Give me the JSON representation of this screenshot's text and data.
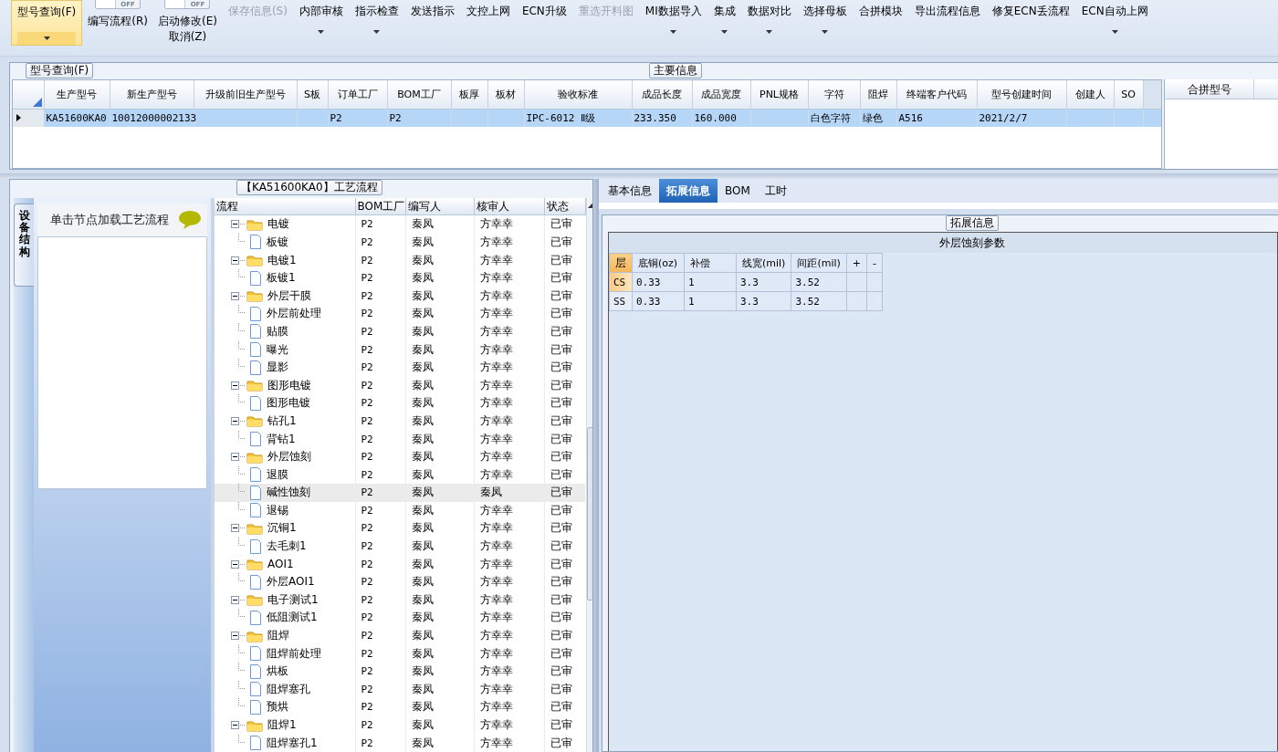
{
  "toolbar": [
    {
      "kind": "button",
      "label": "型号查询(F)",
      "dropdown": true,
      "selected": true,
      "disabled": false
    },
    {
      "kind": "toggle",
      "toggle": "OFF",
      "on": false,
      "lines": [
        "编写流程(R)"
      ]
    },
    {
      "kind": "toggle",
      "toggle": "OFF",
      "on": false,
      "lines": [
        "启动修改(E)",
        "取消(Z)"
      ]
    },
    {
      "kind": "button",
      "label": "保存信息(S)",
      "dropdown": false,
      "selected": false,
      "disabled": true
    },
    {
      "kind": "button",
      "label": "内部审核",
      "dropdown": true,
      "selected": false,
      "disabled": false
    },
    {
      "kind": "button",
      "label": "指示检查",
      "dropdown": true,
      "selected": false,
      "disabled": false
    },
    {
      "kind": "button",
      "label": "发送指示",
      "dropdown": false,
      "selected": false,
      "disabled": false
    },
    {
      "kind": "button",
      "label": "文控上网",
      "dropdown": false,
      "selected": false,
      "disabled": false
    },
    {
      "kind": "button",
      "label": "ECN升级",
      "dropdown": false,
      "selected": false,
      "disabled": false
    },
    {
      "kind": "button",
      "label": "重选开料图",
      "dropdown": false,
      "selected": false,
      "disabled": true
    },
    {
      "kind": "button",
      "label": "MI数据导入",
      "dropdown": true,
      "selected": false,
      "disabled": false
    },
    {
      "kind": "button",
      "label": "集成",
      "dropdown": true,
      "selected": false,
      "disabled": false
    },
    {
      "kind": "button",
      "label": "数据对比",
      "dropdown": true,
      "selected": false,
      "disabled": false
    },
    {
      "kind": "button",
      "label": "选择母板",
      "dropdown": true,
      "selected": false,
      "disabled": false
    },
    {
      "kind": "button",
      "label": "合拼模块",
      "dropdown": false,
      "selected": false,
      "disabled": false
    },
    {
      "kind": "button",
      "label": "导出流程信息",
      "dropdown": false,
      "selected": false,
      "disabled": false
    },
    {
      "kind": "button",
      "label": "修复ECN丢流程",
      "dropdown": false,
      "selected": false,
      "disabled": false
    },
    {
      "kind": "button",
      "label": "ECN自动上网",
      "dropdown": true,
      "selected": false,
      "disabled": false
    }
  ],
  "main_info": {
    "group_label": "型号查询(F)",
    "title": "主要信息",
    "columns": [
      "生产型号",
      "新生产型号",
      "升级前旧生产型号",
      "S板",
      "订单工厂",
      "BOM工厂",
      "板厚",
      "板材",
      "验收标准",
      "成品长度",
      "成品宽度",
      "PNL规格",
      "字符",
      "阻焊",
      "终端客户代码",
      "型号创建时间",
      "创建人",
      "SO"
    ],
    "rows": [
      {
        "selected": true,
        "cells": [
          "KA51600KA0",
          "10012000002133",
          null,
          null,
          "P2",
          "P2",
          null,
          null,
          "IPC-6012 Ⅱ级",
          "233.350",
          "160.000",
          null,
          "白色字符",
          "绿色",
          "A516",
          "2021/2/7",
          null,
          null
        ]
      }
    ],
    "merge_columns": [
      "合拼型号"
    ]
  },
  "process": {
    "title": "【KA51600KA0】工艺流程",
    "side_tab": "设备结构",
    "hint": "单击节点加载工艺流程",
    "columns": [
      "流程",
      "BOM工厂",
      "编写人",
      "核审人",
      "状态"
    ],
    "tree": [
      {
        "kind": "folder",
        "name": "电镀",
        "expanded": true,
        "selected": false,
        "bom": "P2",
        "writer": "秦凤",
        "reviewer": "方幸幸",
        "status": "已审",
        "children": [
          {
            "kind": "file",
            "name": "板镀",
            "selected": false,
            "bom": "P2",
            "writer": "秦凤",
            "reviewer": "方幸幸",
            "status": "已审"
          }
        ]
      },
      {
        "kind": "folder",
        "name": "电镀1",
        "expanded": true,
        "selected": false,
        "bom": "P2",
        "writer": "秦凤",
        "reviewer": "方幸幸",
        "status": "已审",
        "children": [
          {
            "kind": "file",
            "name": "板镀1",
            "selected": false,
            "bom": "P2",
            "writer": "秦凤",
            "reviewer": "方幸幸",
            "status": "已审"
          }
        ]
      },
      {
        "kind": "folder",
        "name": "外层干膜",
        "expanded": true,
        "selected": false,
        "bom": "P2",
        "writer": "秦凤",
        "reviewer": "方幸幸",
        "status": "已审",
        "children": [
          {
            "kind": "file",
            "name": "外层前处理",
            "selected": false,
            "bom": "P2",
            "writer": "秦凤",
            "reviewer": "方幸幸",
            "status": "已审"
          },
          {
            "kind": "file",
            "name": "贴膜",
            "selected": false,
            "bom": "P2",
            "writer": "秦凤",
            "reviewer": "方幸幸",
            "status": "已审"
          },
          {
            "kind": "file",
            "name": "曝光",
            "selected": false,
            "bom": "P2",
            "writer": "秦凤",
            "reviewer": "方幸幸",
            "status": "已审"
          },
          {
            "kind": "file",
            "name": "显影",
            "selected": false,
            "bom": "P2",
            "writer": "秦凤",
            "reviewer": "方幸幸",
            "status": "已审"
          }
        ]
      },
      {
        "kind": "folder",
        "name": "图形电镀",
        "expanded": true,
        "selected": false,
        "bom": "P2",
        "writer": "秦凤",
        "reviewer": "方幸幸",
        "status": "已审",
        "children": [
          {
            "kind": "file",
            "name": "图形电镀",
            "selected": false,
            "bom": "P2",
            "writer": "秦凤",
            "reviewer": "方幸幸",
            "status": "已审"
          }
        ]
      },
      {
        "kind": "folder",
        "name": "钻孔1",
        "expanded": true,
        "selected": false,
        "bom": "P2",
        "writer": "秦凤",
        "reviewer": "方幸幸",
        "status": "已审",
        "children": [
          {
            "kind": "file",
            "name": "背钻1",
            "selected": false,
            "bom": "P2",
            "writer": "秦凤",
            "reviewer": "方幸幸",
            "status": "已审"
          }
        ]
      },
      {
        "kind": "folder",
        "name": "外层蚀刻",
        "expanded": true,
        "selected": false,
        "bom": "P2",
        "writer": "秦凤",
        "reviewer": "方幸幸",
        "status": "已审",
        "children": [
          {
            "kind": "file",
            "name": "退膜",
            "selected": false,
            "bom": "P2",
            "writer": "秦凤",
            "reviewer": "方幸幸",
            "status": "已审"
          },
          {
            "kind": "file",
            "name": "碱性蚀刻",
            "selected": true,
            "bom": "P2",
            "writer": "秦凤",
            "reviewer": "秦凤",
            "status": "已审"
          },
          {
            "kind": "file",
            "name": "退锡",
            "selected": false,
            "bom": "P2",
            "writer": "秦凤",
            "reviewer": "方幸幸",
            "status": "已审"
          }
        ]
      },
      {
        "kind": "folder",
        "name": "沉铜1",
        "expanded": true,
        "selected": false,
        "bom": "P2",
        "writer": "秦凤",
        "reviewer": "方幸幸",
        "status": "已审",
        "children": [
          {
            "kind": "file",
            "name": "去毛刺1",
            "selected": false,
            "bom": "P2",
            "writer": "秦凤",
            "reviewer": "方幸幸",
            "status": "已审"
          }
        ]
      },
      {
        "kind": "folder",
        "name": "AOI1",
        "expanded": true,
        "selected": false,
        "bom": "P2",
        "writer": "秦凤",
        "reviewer": "方幸幸",
        "status": "已审",
        "children": [
          {
            "kind": "file",
            "name": "外层AOI1",
            "selected": false,
            "bom": "P2",
            "writer": "秦凤",
            "reviewer": "方幸幸",
            "status": "已审"
          }
        ]
      },
      {
        "kind": "folder",
        "name": "电子测试1",
        "expanded": true,
        "selected": false,
        "bom": "P2",
        "writer": "秦凤",
        "reviewer": "方幸幸",
        "status": "已审",
        "children": [
          {
            "kind": "file",
            "name": "低阻测试1",
            "selected": false,
            "bom": "P2",
            "writer": "秦凤",
            "reviewer": "方幸幸",
            "status": "已审"
          }
        ]
      },
      {
        "kind": "folder",
        "name": "阻焊",
        "expanded": true,
        "selected": false,
        "bom": "P2",
        "writer": "秦凤",
        "reviewer": "方幸幸",
        "status": "已审",
        "children": [
          {
            "kind": "file",
            "name": "阻焊前处理",
            "selected": false,
            "bom": "P2",
            "writer": "秦凤",
            "reviewer": "方幸幸",
            "status": "已审"
          },
          {
            "kind": "file",
            "name": "烘板",
            "selected": false,
            "bom": "P2",
            "writer": "秦凤",
            "reviewer": "方幸幸",
            "status": "已审"
          },
          {
            "kind": "file",
            "name": "阻焊塞孔",
            "selected": false,
            "bom": "P2",
            "writer": "秦凤",
            "reviewer": "方幸幸",
            "status": "已审"
          },
          {
            "kind": "file",
            "name": "预烘",
            "selected": false,
            "bom": "P2",
            "writer": "秦凤",
            "reviewer": "方幸幸",
            "status": "已审"
          }
        ]
      },
      {
        "kind": "folder",
        "name": "阻焊1",
        "expanded": true,
        "selected": false,
        "bom": "P2",
        "writer": "秦凤",
        "reviewer": "方幸幸",
        "status": "已审",
        "children": [
          {
            "kind": "file",
            "name": "阻焊塞孔1",
            "selected": false,
            "bom": "P2",
            "writer": "秦凤",
            "reviewer": "方幸幸",
            "status": "已审"
          }
        ]
      }
    ]
  },
  "detail": {
    "tabs": [
      {
        "label": "基本信息",
        "selected": false
      },
      {
        "label": "拓展信息",
        "selected": true
      },
      {
        "label": "BOM",
        "selected": false
      },
      {
        "label": "工时",
        "selected": false
      }
    ],
    "group_label": "拓展信息",
    "table_title": "外层蚀刻参数",
    "columns": [
      "层",
      "底铜(oz)",
      "补偿",
      "线宽(mil)",
      "间距(mil)",
      "+",
      "-"
    ],
    "rows": [
      {
        "selected": true,
        "cells": [
          "CS",
          "0.33",
          "1",
          "3.3",
          "3.52"
        ]
      },
      {
        "selected": false,
        "cells": [
          "SS",
          "0.33",
          "1",
          "3.3",
          "3.52"
        ]
      }
    ]
  }
}
